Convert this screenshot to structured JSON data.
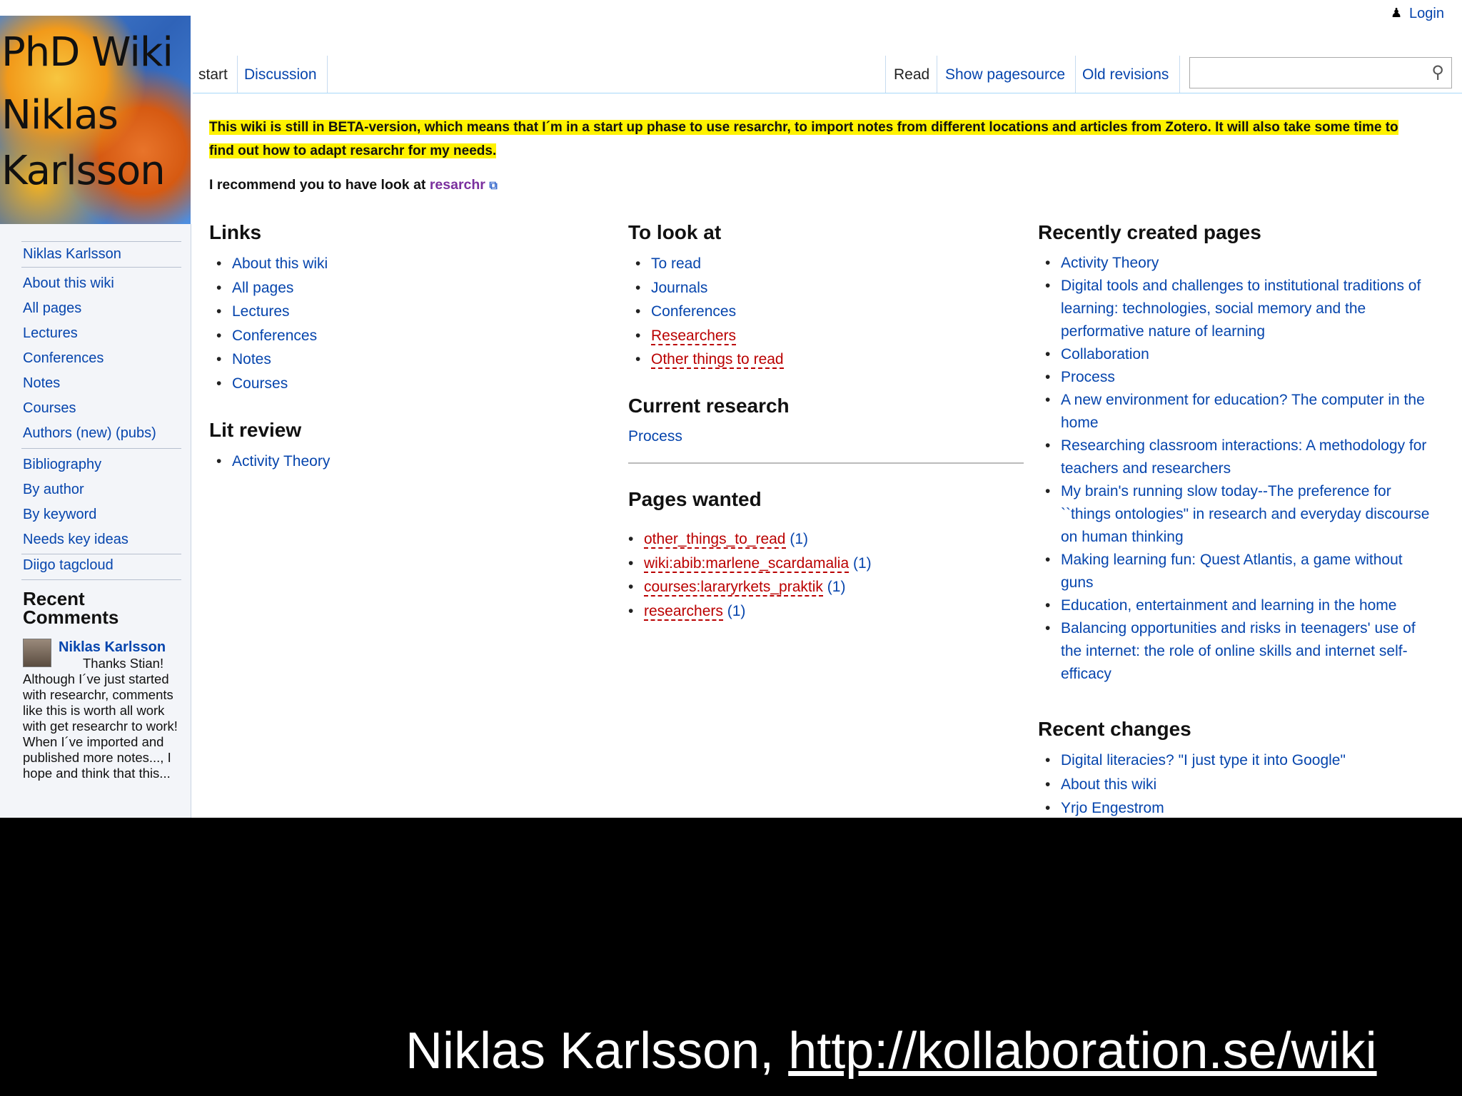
{
  "logo": {
    "lines": [
      "PhD Wiki",
      "Niklas",
      "Karlsson"
    ]
  },
  "header": {
    "login_label": "Login",
    "tabs_left": [
      "start",
      "Discussion"
    ],
    "tabs_right": [
      "Read",
      "Show pagesource",
      "Old revisions"
    ],
    "search": {
      "placeholder": ""
    }
  },
  "sidebar": {
    "links": [
      "Niklas Karlsson",
      "About this wiki",
      "All pages",
      "Lectures",
      "Conferences",
      "Notes",
      "Courses",
      "Authors (new) (pubs)",
      "Bibliography",
      "By author",
      "By keyword",
      "Needs key ideas",
      "Diigo tagcloud"
    ],
    "recent_comments_title_1": "Recent",
    "recent_comments_title_2": "Comments",
    "comment": {
      "author": "Niklas Karlsson",
      "text": "Thanks Stian! Although I´ve just started with researchr, comments like this is worth all work with get researchr to work! When I´ve imported and published more notes..., I hope and think that this..."
    }
  },
  "main": {
    "notice": "This wiki is still in BETA-version, which means that I´m in a start up phase to use resarchr, to import notes from different locations and articles from Zotero. It will also take some time to find out how to adapt resarchr for my needs.",
    "recommend_prefix": "I recommend you to have look at",
    "recommend_link": "resarchr",
    "links": {
      "title": "Links",
      "items": [
        "About this wiki",
        "All pages",
        "Lectures",
        "Conferences",
        "Notes",
        "Courses"
      ]
    },
    "lit_review": {
      "title": "Lit review",
      "items": [
        "Activity Theory"
      ]
    },
    "to_look_at": {
      "title": "To look at",
      "items": [
        {
          "label": "To read",
          "missing": false
        },
        {
          "label": "Journals",
          "missing": false
        },
        {
          "label": "Conferences",
          "missing": false
        },
        {
          "label": "Researchers",
          "missing": true
        },
        {
          "label": "Other things to read",
          "missing": true
        }
      ]
    },
    "current_research": {
      "title": "Current research",
      "link": "Process"
    },
    "pages_wanted": {
      "title": "Pages wanted",
      "items": [
        {
          "label": "other_things_to_read",
          "count": "(1)"
        },
        {
          "label": "wiki:abib:marlene_scardamalia",
          "count": "(1)"
        },
        {
          "label": "courses:lararyrkets_praktik",
          "count": "(1)"
        },
        {
          "label": "researchers",
          "count": "(1)"
        }
      ]
    },
    "recently_created": {
      "title": "Recently created pages",
      "items": [
        "Activity Theory",
        "Digital tools and challenges to institutional traditions of learning: technologies, social memory and the performative nature of learning",
        "Collaboration",
        "Process",
        "A new environment for education? The computer in the home",
        "Researching classroom interactions: A methodology for teachers and researchers",
        "My brain's running slow today--The preference for ``things ontologies\" in research and everyday discourse on human thinking",
        "Making learning fun: Quest Atlantis, a game without guns",
        "Education, entertainment and learning in the home",
        "Balancing opportunities and risks in teenagers' use of the internet: the role of online skills and internet self-efficacy"
      ]
    },
    "recent_changes": {
      "title": "Recent changes",
      "items": [
        "Digital literacies? \"I just type it into Google\"",
        "About this wiki",
        "Yrjo Engestrom"
      ]
    }
  },
  "caption": {
    "name": "Niklas Karlsson,",
    "url": "http://kollaboration.se/wiki"
  }
}
